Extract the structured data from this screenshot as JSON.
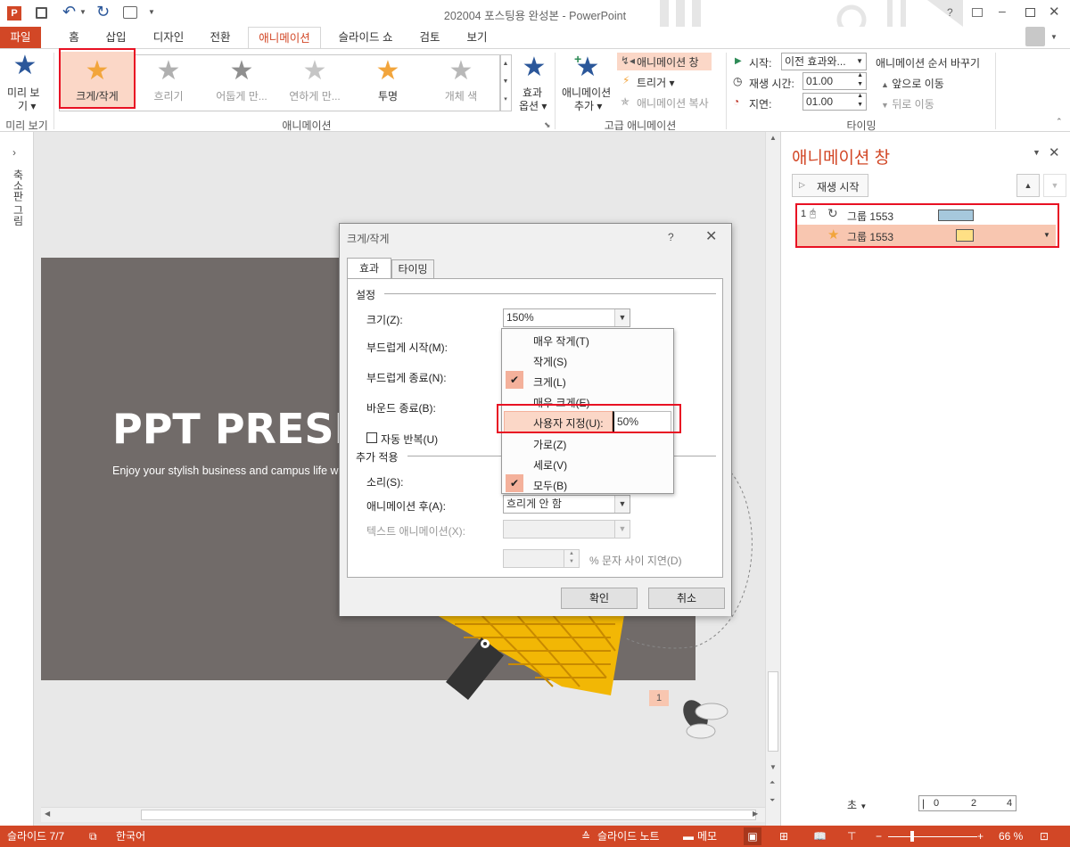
{
  "window": {
    "title": "202004 포스팅용 완성본 - PowerPoint",
    "app_icon": "P",
    "controls": [
      "?",
      "▫",
      "–",
      "□",
      "✕"
    ]
  },
  "tabs": [
    {
      "label": "파일",
      "active": false,
      "file": true
    },
    {
      "label": "홈"
    },
    {
      "label": "삽입"
    },
    {
      "label": "디자인"
    },
    {
      "label": "전환"
    },
    {
      "label": "애니메이션",
      "active": true
    },
    {
      "label": "슬라이드 쇼"
    },
    {
      "label": "검토"
    },
    {
      "label": "보기"
    }
  ],
  "ribbon": {
    "preview": {
      "label1": "미리 보",
      "label2": "기",
      "group": "미리 보기"
    },
    "animations": [
      {
        "label": "크게/작게",
        "color": "#f2a53c",
        "selected": true
      },
      {
        "label": "흐리기",
        "color": "#b0b0b0"
      },
      {
        "label": "어둡게 만...",
        "color": "#9a9a9a"
      },
      {
        "label": "연하게 만...",
        "color": "#c5c5c5"
      },
      {
        "label": "투명",
        "color": "#f2a53c"
      },
      {
        "label": "개체 색",
        "color": "#b8b8b8"
      }
    ],
    "effect_options": {
      "label1": "효과",
      "label2": "옵션"
    },
    "animations_group": "애니메이션",
    "add_animation": {
      "label1": "애니메이션",
      "label2": "추가"
    },
    "animation_pane_btn": "애니메이션 창",
    "trigger_btn": "트리거",
    "painter_btn": "애니메이션 복사",
    "advanced_group": "고급 애니메이션",
    "timing": {
      "start_label": "시작:",
      "start_value": "이전 효과와...",
      "duration_label": "재생 시간:",
      "duration_value": "01.00",
      "delay_label": "지연:",
      "delay_value": "01.00",
      "reorder_title": "애니메이션 순서 바꾸기",
      "move_earlier": "앞으로 이동",
      "move_later": "뒤로 이동",
      "group": "타이밍"
    }
  },
  "left_pane": {
    "label": "축소판 그림"
  },
  "slide": {
    "title": "PPT PRESE",
    "subtitle": "Enjoy your stylish business and campus life w",
    "badge": "1",
    "bg_color": "#716b69"
  },
  "anim_pane": {
    "title": "애니메이션 창",
    "play_btn": "재생 시작",
    "items": [
      {
        "num": "1",
        "name": "그룹 1553",
        "bar_color": "#a6c8dc"
      },
      {
        "name": "그룹 1553",
        "bar_color": "#ffe085",
        "selected": true
      }
    ],
    "seconds_label": "초",
    "timeline_ticks": [
      "0",
      "2",
      "4"
    ]
  },
  "dialog": {
    "title": "크게/작게",
    "help": "?",
    "tabs": [
      "효과",
      "타이밍"
    ],
    "settings_header": "설정",
    "size_label": "크기(Z):",
    "size_value": "150%",
    "smooth_start": "부드럽게 시작(M):",
    "smooth_end": "부드럽게 종료(N):",
    "bounce_end": "바운드 종료(B):",
    "auto_reverse": "자동 반복(U)",
    "enhancements_header": "추가 적용",
    "sound_label": "소리(S):",
    "after_anim_label": "애니메이션 후(A):",
    "after_anim_value": "흐리게 안 함",
    "animate_text_label": "텍스트 애니메이션(X):",
    "delay_between_label": "% 문자 사이 지연(D)",
    "ok": "확인",
    "cancel": "취소"
  },
  "size_menu": {
    "items": [
      {
        "label": "매우 작게(T)",
        "checked": false
      },
      {
        "label": "작게(S)",
        "checked": false
      },
      {
        "label": "크게(L)",
        "checked": true
      },
      {
        "label": "매우 크게(E)",
        "checked": false
      },
      {
        "label": "사용자 지정(U):",
        "custom_value": "50%",
        "highlight": true
      },
      {
        "label": "가로(Z)",
        "checked": false
      },
      {
        "label": "세로(V)",
        "checked": false
      },
      {
        "label": "모두(B)",
        "checked": true
      }
    ]
  },
  "status": {
    "slide": "슬라이드 7/7",
    "language": "한국어",
    "notes": "슬라이드 노트",
    "comments": "메모",
    "zoom": "66 %"
  },
  "colors": {
    "accent": "#d24726",
    "highlight": "#f4b19b",
    "redbox": "#e81123"
  }
}
